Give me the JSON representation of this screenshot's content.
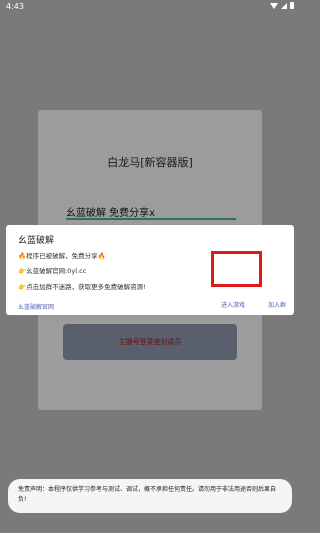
{
  "statusbar": {
    "time": "4:43"
  },
  "background": {
    "title": "白龙马[新容器版]",
    "input_value": "幺蓝破解 免费分享x",
    "button_label": "主播号登录鉴别成员"
  },
  "dialog": {
    "title": "幺蓝破解",
    "line1_icon": "🔥",
    "line1_text": "程序已被破解，免费分享",
    "line1_icon_end": "🔥",
    "line2_icon": "👉",
    "line2_text": "幺蓝破解官网:0yl.cc",
    "line3_icon": "👉",
    "line3_text": "点击加群不迷路，获取更多免费破解资源!",
    "link_label": "幺蓝破解官网",
    "enter_label": "进入游戏",
    "join_label": "加入群"
  },
  "toast": {
    "text": "免责声明：本程序仅供学习参考与测试、调试，概不承担任何责任。请勿用于非法用途否则后果自负!"
  },
  "colors": {
    "highlight": "#e01818",
    "link": "#5062b8"
  }
}
